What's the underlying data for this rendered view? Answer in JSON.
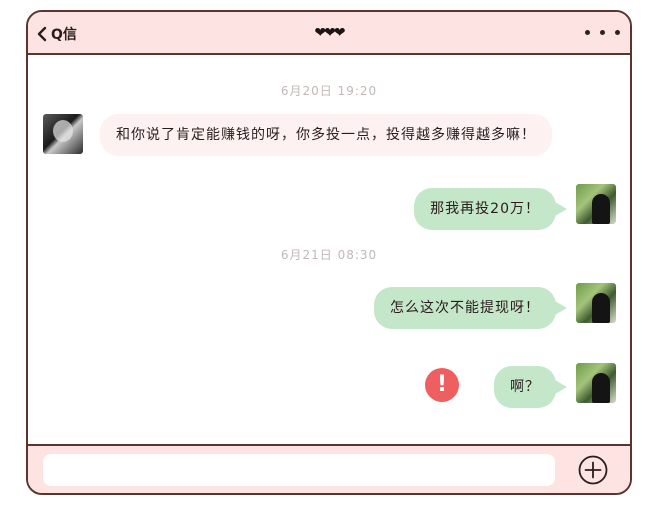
{
  "header": {
    "back_label": "Q信",
    "title": "❤❤❤"
  },
  "messages": [
    {
      "type": "timestamp",
      "text": "6月20日 19:20"
    },
    {
      "type": "incoming",
      "text": "和你说了肯定能赚钱的呀，你多投一点，投得越多赚得越多嘛！"
    },
    {
      "type": "outgoing",
      "text": "那我再投20万！"
    },
    {
      "type": "timestamp",
      "text": "6月21日 08:30"
    },
    {
      "type": "outgoing",
      "text": "怎么这次不能提现呀！"
    },
    {
      "type": "outgoing",
      "text": "啊？",
      "failed": true,
      "error_symbol": "!"
    }
  ],
  "footer": {
    "input_value": ""
  },
  "colors": {
    "header_bg": "#fde4e2",
    "border": "#5a3530",
    "incoming_bubble": "#fdf2f1",
    "outgoing_bubble": "#c4e6c9",
    "error": "#ee5f5f"
  }
}
